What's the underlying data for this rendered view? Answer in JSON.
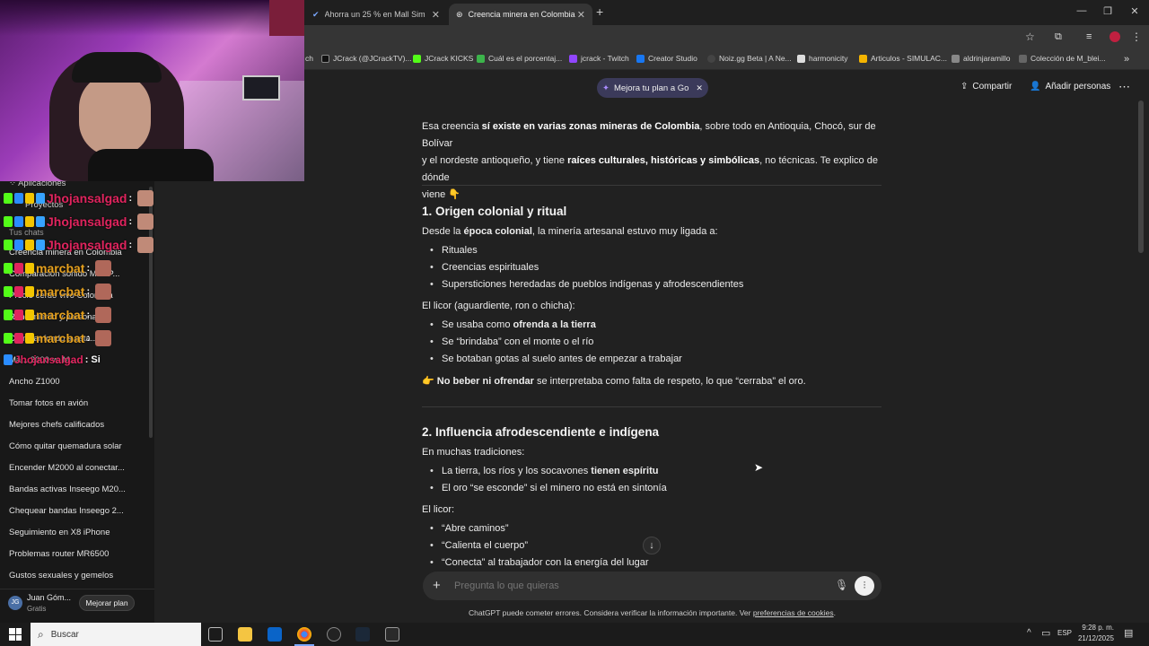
{
  "browser": {
    "tabs": [
      {
        "label": "Ahorra un 25 % en Mall Simula",
        "active": false
      },
      {
        "label": "Creencia minera en Colombia",
        "active": true
      }
    ],
    "bookmarks": [
      "ch",
      "JCrack (@JCrackTV)...",
      "JCrack KICKS",
      "Cuál es el porcentaj...",
      "jcrack - Twitch",
      "Creator Studio",
      "Noiz.gg Beta | A Ne...",
      "harmonicity",
      "Articulos - SIMULAC...",
      "aldrinjaramillo",
      "Colección de M_blei..."
    ]
  },
  "header": {
    "upgrade_pill": "Mejora tu plan a Go",
    "share": "Compartir",
    "add_people": "Añadir personas"
  },
  "sidebar": {
    "items": [
      "Aplicaciones",
      "Proyectos",
      "Tus chats",
      "Creencia minera en Colombia",
      "Comparación sonido Max P...",
      "Precio cerdo vivo Colombia",
      "Rendimiento y personaliz...",
      "Cambiar fondo a esta...",
      "Ma... 2000 vs M...",
      "Ancho Z1000",
      "Tomar fotos en avión",
      "Mejores chefs calificados",
      "Cómo quitar quemadura solar",
      "Encender M2000 al conectar...",
      "Bandas activas Inseego M20...",
      "Chequear bandas Inseego 2...",
      "Seguimiento en X8 iPhone",
      "Problemas router MR6500",
      "Gustos sexuales y gemelos"
    ],
    "user_name": "Juan Góm...",
    "user_plan": "Gratis",
    "user_initials": "JG",
    "upgrade_button": "Mejorar plan"
  },
  "stream_chat": [
    {
      "user": "Jhojansalgad",
      "color": "#e0245e",
      "msg": ":"
    },
    {
      "user": "Jhojansalgad",
      "color": "#e0245e",
      "msg": ":"
    },
    {
      "user": "Jhojansalgad",
      "color": "#e0245e",
      "msg": ":"
    },
    {
      "user": "marcbat",
      "color": "#e6a11e",
      "msg": ":"
    },
    {
      "user": "marcbat",
      "color": "#e6a11e",
      "msg": ":"
    },
    {
      "user": "marcbat",
      "color": "#e6a11e",
      "msg": ":"
    },
    {
      "user": "marcbat",
      "color": "#e6a11e",
      "msg": ":"
    },
    {
      "user": "Jhojansalgad",
      "color": "#e0245e",
      "msg": ": Si"
    }
  ],
  "article": {
    "intro_a": "Esa creencia ",
    "intro_b": "sí existe en varias zonas mineras de Colombia",
    "intro_c": ", sobre todo en Antioquia, Chocó, sur de Bolívar",
    "intro_d": "y el nordeste antioqueño, y tiene ",
    "intro_e": "raíces culturales, históricas y simbólicas",
    "intro_f": ", no técnicas. Te explico de dónde",
    "intro_g": "viene 👇",
    "s1_title": "1. Origen colonial y ritual",
    "s1_p_a": "Desde la ",
    "s1_p_b": "época colonial",
    "s1_p_c": ", la minería artesanal estuvo muy ligada a:",
    "s1_list": [
      "Rituales",
      "Creencias espirituales",
      "Supersticiones heredadas de pueblos indígenas y afrodescendientes"
    ],
    "s1_licor": "El licor (aguardiente, ron o chicha):",
    "s1_list2_a": "Se usaba como ",
    "s1_list2_a_b": "ofrenda a la tierra",
    "s1_list2_b": "Se “brindaba” con el monte o el río",
    "s1_list2_c": "Se botaban gotas al suelo antes de empezar a trabajar",
    "s1_note_emoji": "👉",
    "s1_note_b": "No beber ni ofrendar",
    "s1_note_c": " se interpretaba como falta de respeto, lo que “cerraba” el oro.",
    "s2_title": "2. Influencia afrodescendiente e indígena",
    "s2_p": "En muchas tradiciones:",
    "s2_li1_a": "La tierra, los ríos y los socavones ",
    "s2_li1_b": "tienen espíritu",
    "s2_li2": "El oro “se esconde” si el minero no está en sintonía",
    "s2_licor": "El licor:",
    "s2_list": [
      "“Abre caminos”",
      "“Calienta el cuerpo”",
      "“Conecta” al trabajador con la energía del lugar"
    ]
  },
  "composer": {
    "placeholder": "Pregunta lo que quieras",
    "disclaimer": "ChatGPT puede cometer errores. Considera verificar la información importante. Ver ",
    "disclaimer_link": "preferencias de cookies",
    "disclaimer_end": "."
  },
  "taskbar": {
    "search": "Buscar",
    "lang": "ESP",
    "time": "9:28 p. m.",
    "date": "21/12/2025"
  }
}
